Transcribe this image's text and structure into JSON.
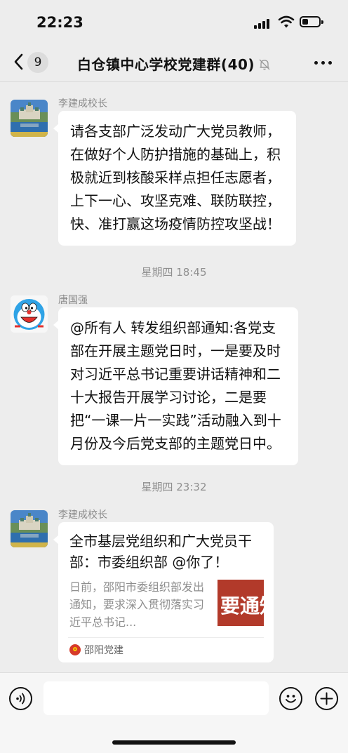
{
  "status_bar": {
    "time": "22:23",
    "battery_level": 0.35
  },
  "nav": {
    "unread_count": "9",
    "title": "白仓镇中心学校党建群(40)"
  },
  "messages": [
    {
      "sender": "李建成校长",
      "text": "请各支部广泛发动广大党员教师，在做好个人防护措施的基础上，积极就近到核酸采样点担任志愿者，上下一心、攻坚克难、联防联控，快、准打赢这场疫情防控攻坚战！"
    },
    {
      "timestamp": "星期四 18:45"
    },
    {
      "sender": "唐国强",
      "text": "@所有人 转发组织部通知:各党支部在开展主题党日时，一是要及时对习近平总书记重要讲话精神和二十大报告开展学习讨论，二是要把“一课一片一实践”活动融入到十月份及今后党支部的主题党日中。"
    },
    {
      "timestamp": "星期四 23:32"
    },
    {
      "sender": "李建成校长",
      "card": {
        "title": "全市基层党组织和广大党员干部：市委组织部 @你了！",
        "description": "日前，邵阳市委组织部发出通知，要求深入贯彻落实习近平总书记...",
        "thumb_text": "要通知",
        "source": "邵阳党建"
      }
    }
  ],
  "input": {
    "value": ""
  }
}
